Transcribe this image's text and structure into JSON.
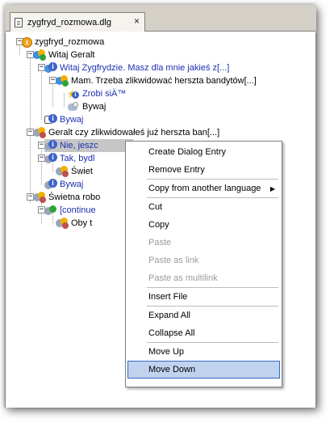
{
  "tab": {
    "title": "zygfryd_rozmowa.dlg",
    "close": "×"
  },
  "tree": {
    "root": "zygfryd_rozmowa",
    "nodes": [
      "Witaj Geralt",
      "Witaj Zygfrydzie. Masz dla mnie jakieś z[...]",
      "Mam. Trzeba zlikwidować herszta bandytów[...]",
      "Zrobi siÄ™",
      "Bywaj",
      "Bywaj",
      "Geralt czy zlikwidowałeś już herszta ban[...]",
      "Nie, jeszc",
      "Tak, bydl",
      "Świet",
      "Bywaj",
      "Świetna robo",
      "[continue",
      "Oby t"
    ],
    "toggles": {
      "expanded": "−"
    }
  },
  "context_menu": {
    "items": [
      "Create Dialog Entry",
      "Remove Entry",
      "Copy from another language",
      "Cut",
      "Copy",
      "Paste",
      "Paste as link",
      "Paste as multilink",
      "Insert File",
      "Expand All",
      "Collapse All",
      "Move Up",
      "Move Down"
    ],
    "submenu_arrow": "▶",
    "disabled": [
      "Paste",
      "Paste as link",
      "Paste as multilink"
    ],
    "highlighted": "Move Down"
  },
  "colors": {
    "link_blue": "#1b2fb0",
    "menu_highlight": "#c1d2ee",
    "selection": "#c6c6c6"
  }
}
